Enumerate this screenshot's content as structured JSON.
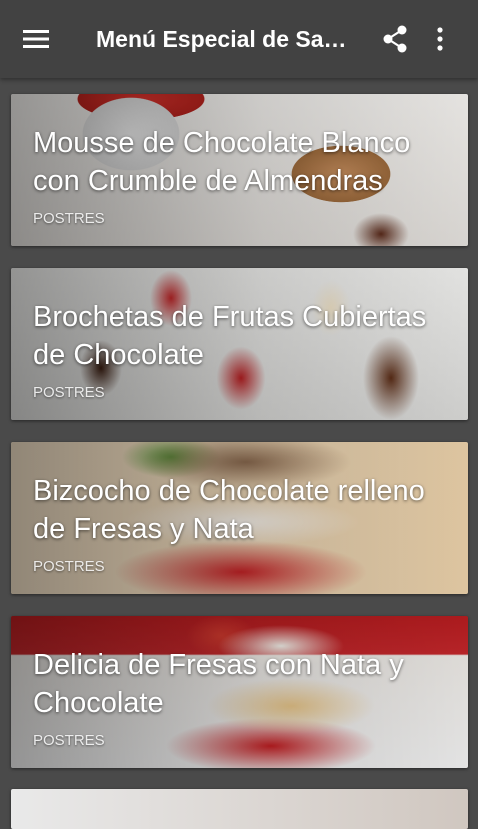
{
  "app_bar": {
    "title": "Menú Especial de San Valentín",
    "menu_icon": "hamburger-menu-icon",
    "share_icon": "share-icon",
    "more_icon": "more-vert-icon"
  },
  "recipes": [
    {
      "title": "Mousse de Chocolate Blanco con Crumble de Almendras",
      "category": "POSTRES"
    },
    {
      "title": "Brochetas de Frutas Cubiertas de Chocolate",
      "category": "POSTRES"
    },
    {
      "title": "Bizcocho de Chocolate relleno de Fresas y Nata",
      "category": "POSTRES"
    },
    {
      "title": "Delicia de Fresas con Nata y Chocolate",
      "category": "POSTRES"
    }
  ],
  "colors": {
    "app_bar": "#424242",
    "background": "#4a4a4a",
    "text": "#ffffff"
  }
}
